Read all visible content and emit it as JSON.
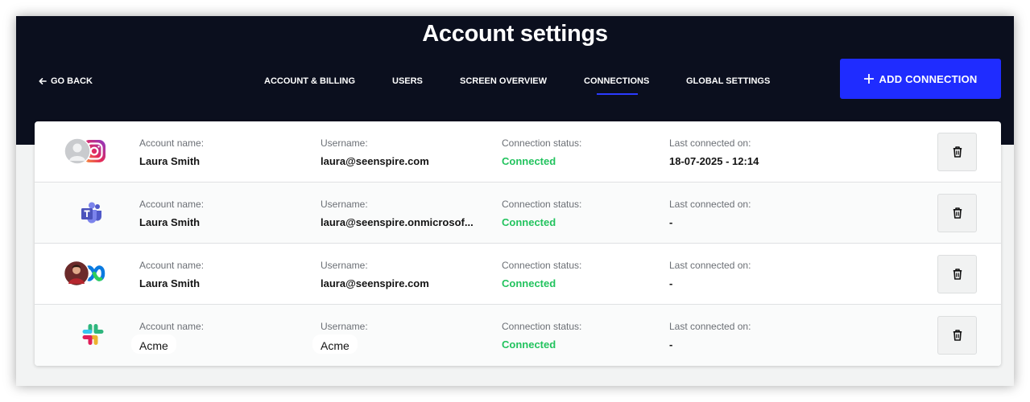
{
  "header": {
    "title": "Account settings",
    "go_back": "GO BACK",
    "add_connection": "ADD CONNECTION"
  },
  "nav": {
    "tabs": [
      {
        "label": "ACCOUNT & BILLING",
        "active": false
      },
      {
        "label": "USERS",
        "active": false
      },
      {
        "label": "SCREEN OVERVIEW",
        "active": false
      },
      {
        "label": "CONNECTIONS",
        "active": true
      },
      {
        "label": "GLOBAL SETTINGS",
        "active": false
      }
    ]
  },
  "labels": {
    "account_name": "Account name:",
    "username": "Username:",
    "status": "Connection status:",
    "last_connected": "Last connected on:"
  },
  "connections": [
    {
      "service": "instagram",
      "icon": "instagram-icon",
      "account_name": "Laura Smith",
      "username": "laura@seenspire.com",
      "status": "Connected",
      "last_connected": "18-07-2025 - 12:14"
    },
    {
      "service": "microsoft-teams",
      "icon": "microsoft-teams-icon",
      "account_name": "Laura Smith",
      "username": "laura@seenspire.onmicrosof...",
      "status": "Connected",
      "last_connected": "-"
    },
    {
      "service": "webex",
      "icon": "webex-icon",
      "account_name": "Laura Smith",
      "username": "laura@seenspire.com",
      "status": "Connected",
      "last_connected": "-"
    },
    {
      "service": "slack",
      "icon": "slack-icon",
      "account_name": "Acme",
      "username": "Acme",
      "status": "Connected",
      "last_connected": "-"
    }
  ],
  "colors": {
    "header_bg": "#0b0f1e",
    "accent": "#1f2cff",
    "status_connected": "#22c35e",
    "page_bg": "#f2f3f3"
  }
}
